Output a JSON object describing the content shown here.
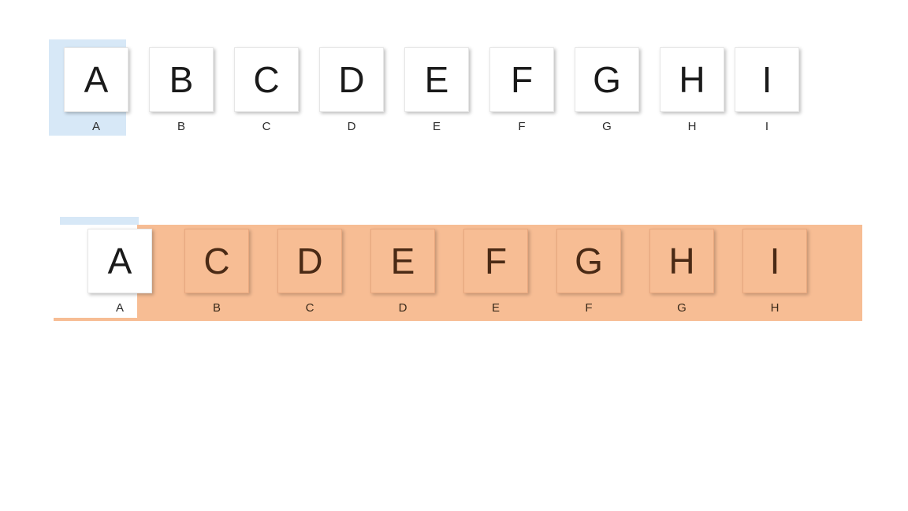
{
  "row1": {
    "selected_index": 0,
    "items": [
      {
        "tile": "A",
        "caption": "A"
      },
      {
        "tile": "B",
        "caption": "B"
      },
      {
        "tile": "C",
        "caption": "C"
      },
      {
        "tile": "D",
        "caption": "D"
      },
      {
        "tile": "E",
        "caption": "E"
      },
      {
        "tile": "F",
        "caption": "F"
      },
      {
        "tile": "G",
        "caption": "G"
      },
      {
        "tile": "H",
        "caption": "H"
      },
      {
        "tile": "I",
        "caption": "I"
      }
    ]
  },
  "row2": {
    "highlighted": true,
    "highlight_color": "#f7bd94",
    "items": [
      {
        "tile": "A",
        "caption": "A",
        "style": "white"
      },
      {
        "tile": "C",
        "caption": "B",
        "style": "orange"
      },
      {
        "tile": "D",
        "caption": "C",
        "style": "orange"
      },
      {
        "tile": "E",
        "caption": "D",
        "style": "orange"
      },
      {
        "tile": "F",
        "caption": "E",
        "style": "orange"
      },
      {
        "tile": "G",
        "caption": "F",
        "style": "orange"
      },
      {
        "tile": "H",
        "caption": "G",
        "style": "orange"
      },
      {
        "tile": "I",
        "caption": "H",
        "style": "orange"
      }
    ]
  }
}
